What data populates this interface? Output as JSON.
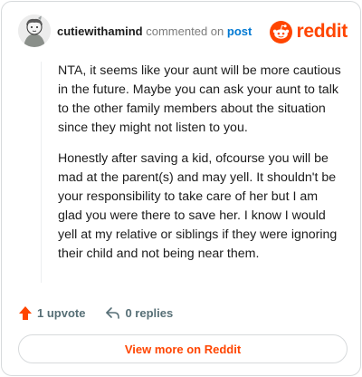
{
  "header": {
    "author": "cutiewithamind",
    "action_text": "commented on",
    "post_link": "post",
    "brand_name": "reddit",
    "brand_color": "#FF4500"
  },
  "comment": {
    "paragraphs": [
      "NTA, it seems like your aunt will be more cautious in the future. Maybe you can ask your aunt to talk to the other family members about the situation since they might not listen to you.",
      "Honestly after saving a kid, ofcourse you will be mad at the parent(s) and may yell. It shouldn't be your responsibility to take care of her but I am glad you were there to save her. I know I would yell at my relative or siblings if they were ignoring their child and not being near them."
    ]
  },
  "actions": {
    "upvote_label": "1 upvote",
    "upvote_icon": "upvote-arrow-icon",
    "reply_label": "0 replies",
    "reply_icon": "reply-arrow-icon"
  },
  "footer": {
    "view_more_label": "View more on Reddit"
  }
}
